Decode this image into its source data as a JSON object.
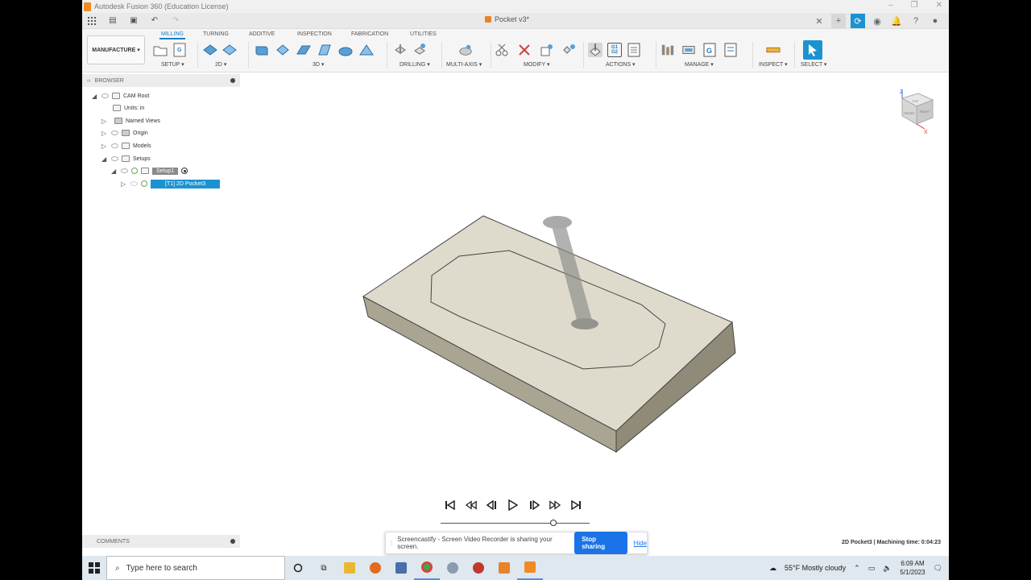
{
  "window": {
    "title": "Autodesk Fusion 360 (Education License)",
    "document_title": "Pocket v3*"
  },
  "toolbar": {
    "workspace": "MANUFACTURE ▾",
    "tabs": [
      "MILLING",
      "TURNING",
      "ADDITIVE",
      "INSPECTION",
      "FABRICATION",
      "UTILITIES"
    ],
    "groups": {
      "setup": "SETUP ▾",
      "g2d": "2D ▾",
      "g3d": "3D ▾",
      "drilling": "DRILLING ▾",
      "multiaxis": "MULTI-AXIS ▾",
      "modify": "MODIFY ▾",
      "actions": "ACTIONS ▾",
      "manage": "MANAGE ▾",
      "inspect": "INSPECT ▾",
      "select": "SELECT ▾"
    },
    "actions_g_code_icon": "G1 G2"
  },
  "browser": {
    "title": "BROWSER",
    "items": [
      {
        "label": "CAM Root"
      },
      {
        "label": "Units: in"
      },
      {
        "label": "Named Views"
      },
      {
        "label": "Origin"
      },
      {
        "label": "Models"
      },
      {
        "label": "Setups"
      },
      {
        "label": "Setup1"
      },
      {
        "label": "[T1] 2D Pocket3"
      }
    ]
  },
  "comments": {
    "title": "COMMENTS"
  },
  "status": {
    "machining_time": "2D Pocket3 | Machining time: 0:04:23"
  },
  "share_bar": {
    "message": "Screencastify - Screen Video Recorder is sharing your screen.",
    "stop_label": "Stop sharing",
    "hide_label": "Hide"
  },
  "viewcube": {
    "axis_z": "Z",
    "axis_x": "X",
    "face_top": "TOP",
    "face_right": "RIGHT",
    "face_front": "FRONT"
  },
  "taskbar": {
    "search_placeholder": "Type here to search",
    "weather": "55°F  Mostly cloudy",
    "time": "6:09 AM",
    "date": "5/1/2023"
  },
  "colors": {
    "accent": "#1b93d1",
    "stock_top": "#dedbcc",
    "stock_side": "#a9a592",
    "tool": "#8a8a88"
  }
}
